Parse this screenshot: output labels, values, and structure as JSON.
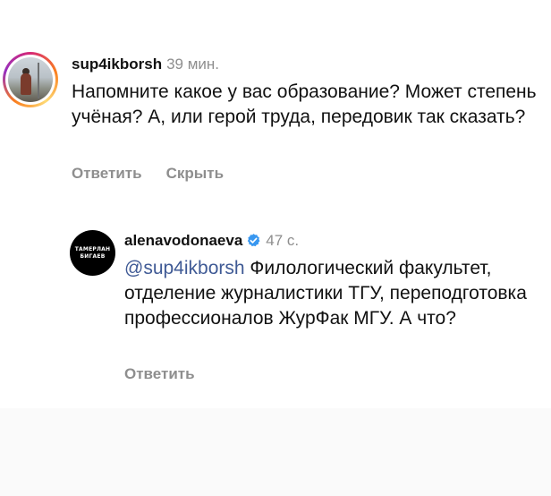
{
  "comments": [
    {
      "username": "sup4ikborsh",
      "time": "39 мин.",
      "text": "Напомните какое у вас образование? Может степень учёная? А, или герой труда, передовик так сказать?",
      "actions": {
        "reply": "Ответить",
        "hide": "Скрыть"
      }
    },
    {
      "username": "alenavodonaeva",
      "verified": true,
      "time": "47 с.",
      "avatar_text": [
        "ТАМЕРЛАН",
        "БИГАЕВ"
      ],
      "mention": "@sup4ikborsh",
      "text": " Филологический факультет, отделение журналистики ТГУ, переподготовка профессионалов ЖурФак МГУ. А что?",
      "actions": {
        "reply": "Ответить"
      }
    }
  ],
  "colors": {
    "mention": "#3f5a95",
    "verified": "#3897f0",
    "muted": "#8e8e8e"
  }
}
